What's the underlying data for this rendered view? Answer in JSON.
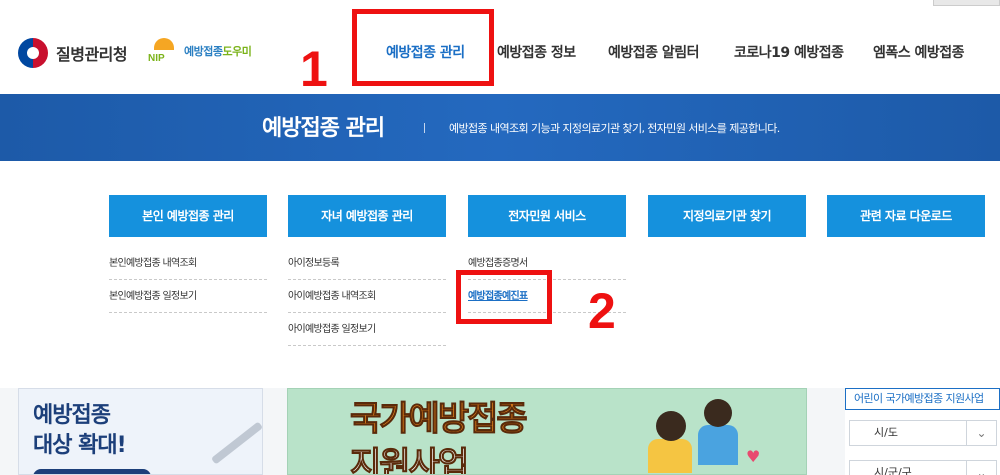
{
  "header": {
    "org_name": "질병관리청",
    "helper_logo": {
      "text": "NIP",
      "name_main": "예방접종",
      "name_accent": "도우미"
    },
    "gnb": [
      {
        "label": "예방접종 관리",
        "active": true
      },
      {
        "label": "예방접종 정보",
        "active": false
      },
      {
        "label": "예방접종 알림터",
        "active": false
      },
      {
        "label": "코로나19 예방접종",
        "active": false
      },
      {
        "label": "엠폭스 예방접종",
        "active": false
      }
    ]
  },
  "band": {
    "title": "예방접종 관리",
    "description": "예방접종 내역조회 기능과 지정의료기관 찾기, 전자민원 서비스를 제공합니다."
  },
  "menu": {
    "columns": [
      {
        "title": "본인 예방접종 관리",
        "links": [
          "본인예방접종 내역조회",
          "본인예방접종 일정보기"
        ]
      },
      {
        "title": "자녀 예방접종 관리",
        "links": [
          "아이정보등록",
          "아이예방접종 내역조회",
          "아이예방접종 일정보기"
        ]
      },
      {
        "title": "전자민원 서비스",
        "links": [
          "예방접종증명서",
          "예방접종예진표"
        ]
      },
      {
        "title": "지정의료기관 찾기",
        "links": []
      },
      {
        "title": "관련 자료 다운로드",
        "links": []
      }
    ],
    "highlighted_link": "예방접종예진표"
  },
  "below": {
    "left_card": {
      "line1": "예방접종",
      "line2": "대상 확대!"
    },
    "center_banner": {
      "line1": "국가예방접종",
      "line2": "지원사업"
    },
    "right_box": {
      "title": "어린이 국가예방접종 지원사업",
      "select1": "시/도",
      "select2": "시/군/구"
    }
  },
  "annotations": {
    "num1": "1",
    "num2": "2"
  },
  "colors": {
    "accent_blue": "#1b6fc5",
    "menu_button": "#1591dd",
    "band": "#2167b8",
    "annotation_red": "#ee1111"
  },
  "icons": [
    "kdca-emblem-icon",
    "nip-logo-icon",
    "syringe-icon",
    "heart-icon",
    "chevron-down-icon"
  ]
}
